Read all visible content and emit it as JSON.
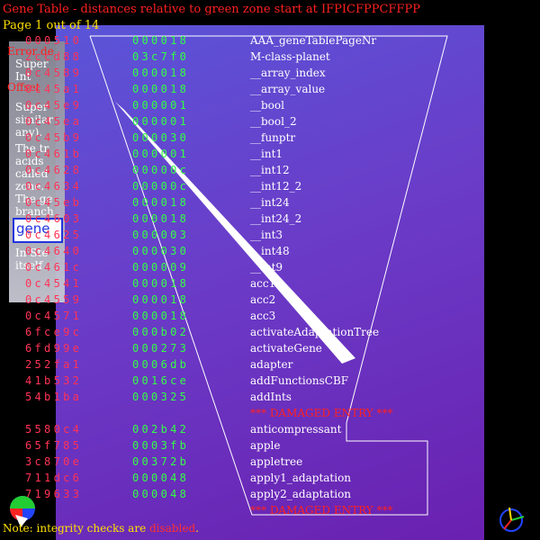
{
  "header": {
    "title": "Gene Table - distances relative to green zone start at IFPICFPPCFFPP",
    "page_info": "Page 1 out of 14"
  },
  "side_labels": {
    "error": "Error de",
    "offset": "Offset"
  },
  "side_panel": {
    "lines": [
      "Super",
      "Int",
      "Super",
      "similar",
      "any).",
      "The tr",
      "acids",
      "called",
      "zone.",
      "The ge",
      "branch",
      "In Ste",
      "itself"
    ],
    "box_text": "gene"
  },
  "rows": [
    {
      "offset": "000510",
      "size": "000018",
      "name": "AAA_geneTablePageNr",
      "damaged": false
    },
    {
      "offset": "2ccd88",
      "size": "03c7f0",
      "name": "M-class-planet",
      "damaged": false
    },
    {
      "offset": "0c4589",
      "size": "000018",
      "name": "__array_index",
      "damaged": false
    },
    {
      "offset": "0c45a1",
      "size": "000018",
      "name": "__array_value",
      "damaged": false
    },
    {
      "offset": "0c45e9",
      "size": "000001",
      "name": "__bool",
      "damaged": false
    },
    {
      "offset": "0c45ea",
      "size": "000001",
      "name": "__bool_2",
      "damaged": false
    },
    {
      "offset": "0c45b9",
      "size": "000030",
      "name": "__funptr",
      "damaged": false
    },
    {
      "offset": "0c461b",
      "size": "000001",
      "name": "__int1",
      "damaged": false
    },
    {
      "offset": "0c4628",
      "size": "00000c",
      "name": "__int12",
      "damaged": false
    },
    {
      "offset": "0c4634",
      "size": "00000c",
      "name": "__int12_2",
      "damaged": false
    },
    {
      "offset": "0c45eb",
      "size": "000018",
      "name": "__int24",
      "damaged": false
    },
    {
      "offset": "0c4603",
      "size": "000018",
      "name": "__int24_2",
      "damaged": false
    },
    {
      "offset": "0c4625",
      "size": "000003",
      "name": "__int3",
      "damaged": false
    },
    {
      "offset": "0c4640",
      "size": "000030",
      "name": "__int48",
      "damaged": false
    },
    {
      "offset": "0c461c",
      "size": "000009",
      "name": "__int9",
      "damaged": false
    },
    {
      "offset": "0c4541",
      "size": "000018",
      "name": "acc1",
      "damaged": false
    },
    {
      "offset": "0c4559",
      "size": "000018",
      "name": "acc2",
      "damaged": false
    },
    {
      "offset": "0c4571",
      "size": "000018",
      "name": "acc3",
      "damaged": false
    },
    {
      "offset": "6fce9c",
      "size": "000b02",
      "name": "activateAdaptationTree",
      "damaged": false
    },
    {
      "offset": "6fd99e",
      "size": "000273",
      "name": "activateGene",
      "damaged": false
    },
    {
      "offset": "252fa1",
      "size": "0006db",
      "name": "adapter",
      "damaged": false
    },
    {
      "offset": "41b532",
      "size": "0016ce",
      "name": "addFunctionsCBF",
      "damaged": false
    },
    {
      "offset": "54b1ba",
      "size": "000325",
      "name": "addInts",
      "damaged": false
    },
    {
      "offset": "",
      "size": "",
      "name": "*** DAMAGED ENTRY ***",
      "damaged": true
    },
    {
      "offset": "5580c4",
      "size": "002b42",
      "name": "anticompressant",
      "damaged": false
    },
    {
      "offset": "65f785",
      "size": "0003fb",
      "name": "apple",
      "damaged": false
    },
    {
      "offset": "3c870e",
      "size": "00372b",
      "name": "appletree",
      "damaged": false
    },
    {
      "offset": "711dc6",
      "size": "000048",
      "name": "apply1_adaptation",
      "damaged": false
    },
    {
      "offset": "719633",
      "size": "000048",
      "name": "apply2_adaptation",
      "damaged": false
    },
    {
      "offset": "",
      "size": "",
      "name": "*** DAMAGED ENTRY ***",
      "damaged": true
    }
  ],
  "footer": {
    "prefix": "Note: integrity checks are ",
    "status": "disabled",
    "suffix": "."
  },
  "colors": {
    "offset": "#ff3355",
    "size": "#33ff44",
    "name": "#ffffff",
    "damaged": "#ff2020",
    "title": "#ff2020",
    "page_info": "#ffe000"
  }
}
